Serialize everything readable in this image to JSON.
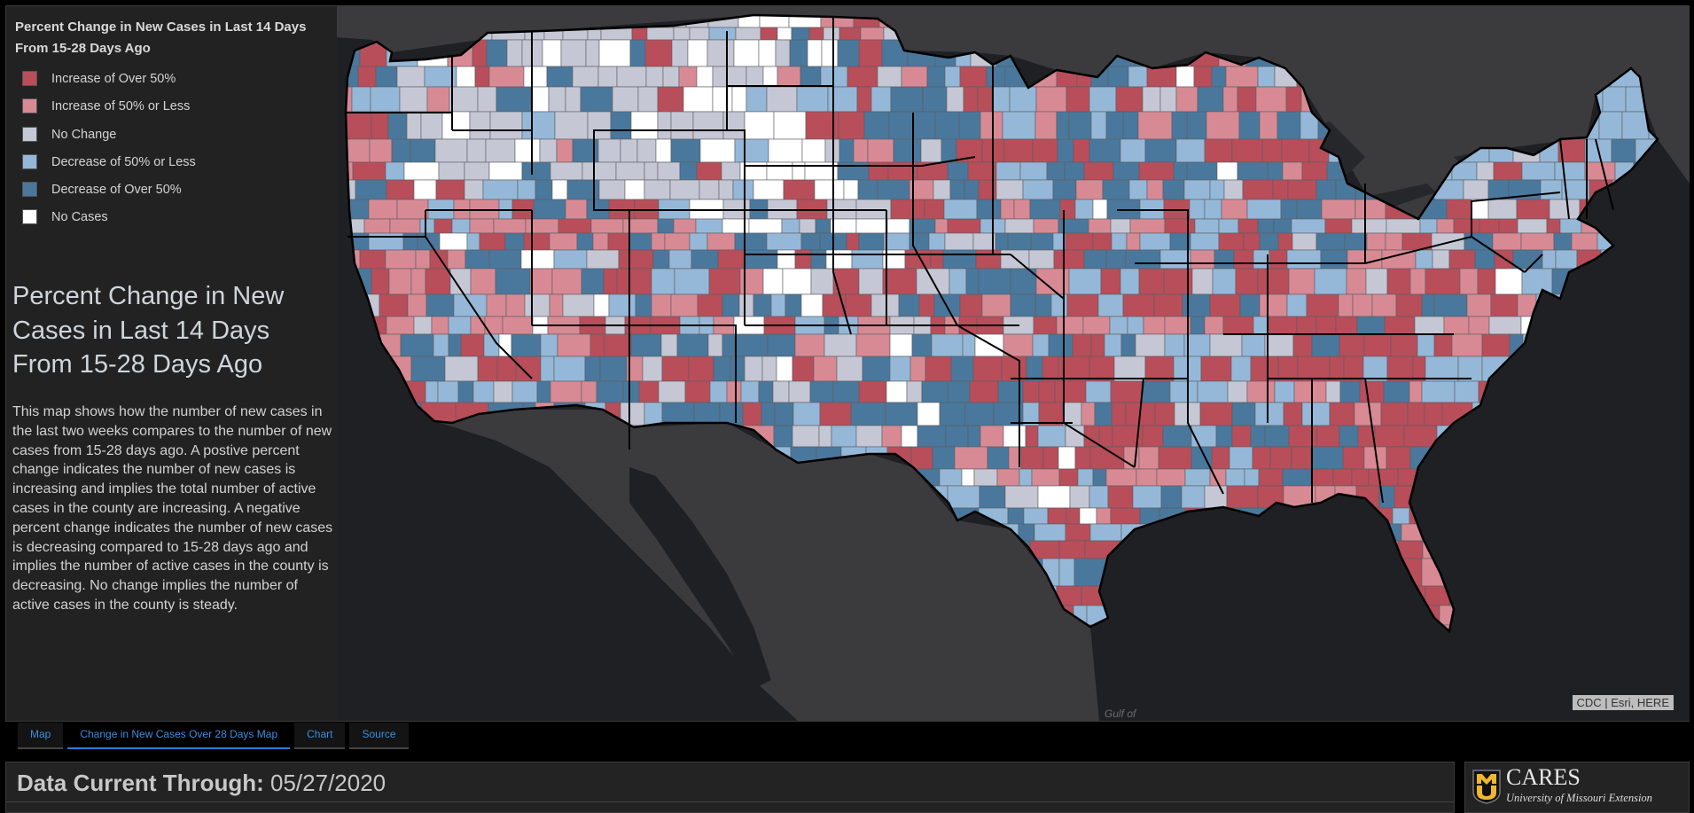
{
  "legend": {
    "title": "Percent Change in New Cases in Last 14 Days From 15-28 Days Ago",
    "items": [
      {
        "label": "Increase of Over 50%",
        "color": "#b84e5a"
      },
      {
        "label": "Increase of 50% or Less",
        "color": "#d88a94"
      },
      {
        "label": "No Change",
        "color": "#c5c8d4"
      },
      {
        "label": "Decrease of 50% or Less",
        "color": "#95b8d8"
      },
      {
        "label": "Decrease of Over 50%",
        "color": "#4a789c"
      },
      {
        "label": "No Cases",
        "color": "#ffffff"
      }
    ]
  },
  "panel": {
    "heading": "Percent Change in New Cases in Last 14 Days From 15-28 Days Ago",
    "description": "This map shows how the number of new cases in the last two weeks compares to the number of new cases from 15-28 days ago. A postive percent change indicates the number of new cases is increasing and implies the total number of active cases in the county are increasing. A negative percent change indicates the number of new cases is decreasing compared to 15-28 days ago and implies the number of active cases in the county is decreasing. No change implies the number of active cases in the county is steady."
  },
  "map": {
    "attribution": "CDC | Esri, HERE",
    "basemap_label": "Gulf of",
    "colors": {
      "land": "#3b3b3e",
      "water": "#1f2023",
      "state_border": "#000000"
    }
  },
  "tabs": [
    {
      "label": "Map",
      "active": false
    },
    {
      "label": "Change in New Cases Over 28 Days Map",
      "active": true
    },
    {
      "label": "Chart",
      "active": false
    },
    {
      "label": "Source",
      "active": false
    }
  ],
  "footer": {
    "date_label": "Data Current Through:",
    "date_value": "05/27/2020",
    "org_name": "CARES",
    "org_sub": "University of Missouri Extension",
    "logo_letters": "MU",
    "logo_color": "#f1b82d"
  }
}
